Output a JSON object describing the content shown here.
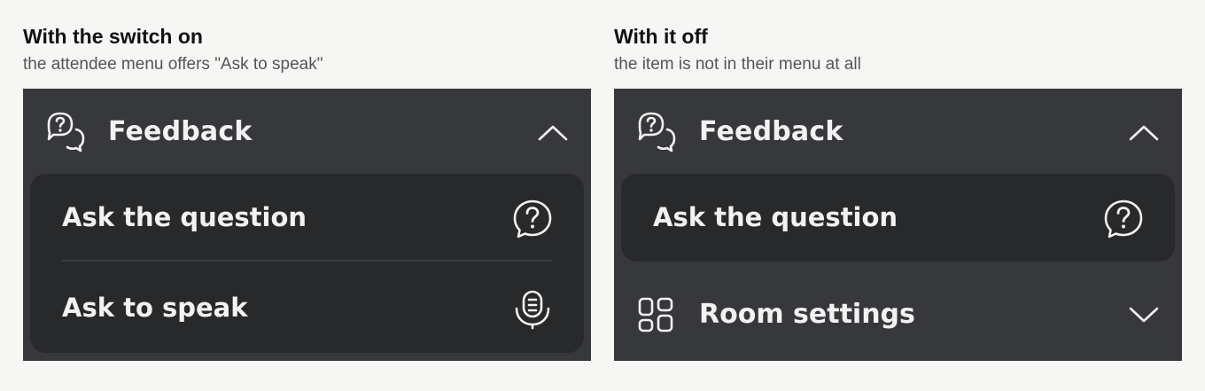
{
  "left": {
    "title": "With the switch on",
    "subtitle": "the attendee menu offers \"Ask to speak\"",
    "panel": {
      "header": {
        "label": "Feedback",
        "icon": "feedback-icon",
        "state": "expanded"
      },
      "items": [
        {
          "label": "Ask the question",
          "icon": "question-icon"
        },
        {
          "label": "Ask to speak",
          "icon": "microphone-icon"
        }
      ]
    }
  },
  "right": {
    "title": "With it off",
    "subtitle": "the item is not in their menu at all",
    "panel": {
      "header": {
        "label": "Feedback",
        "icon": "feedback-icon",
        "state": "expanded"
      },
      "items": [
        {
          "label": "Ask the question",
          "icon": "question-icon"
        }
      ],
      "next_section": {
        "label": "Room settings",
        "icon": "grid-icon",
        "state": "collapsed"
      }
    }
  },
  "colors": {
    "page_bg": "#f6f6f4",
    "panel_bg": "#37383b",
    "submenu_bg": "#28292b",
    "text": "#f2f2f2"
  }
}
